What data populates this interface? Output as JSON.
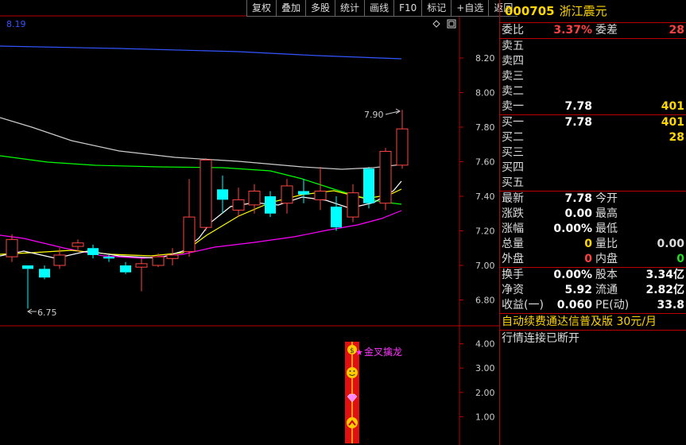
{
  "toolbar": [
    "复权",
    "叠加",
    "多股",
    "统计",
    "画线",
    "F10",
    "标记",
    "+自选",
    "返回"
  ],
  "chart": {
    "ma_label": "8.19",
    "price_axis": [
      "8.20",
      "8.00",
      "7.80",
      "7.60",
      "7.40",
      "7.20",
      "7.00",
      "6.80"
    ],
    "high_mark": "7.90",
    "low_mark": "6.75",
    "indicator_axis": [
      "4.00",
      "3.00",
      "2.00",
      "1.00"
    ],
    "signal_text": "金叉擒龙",
    "colors": {
      "up": "#ff4444",
      "down": "#00ffff",
      "ma5": "#ffffff",
      "ma10": "#ffff00",
      "ma20": "#ff00ff",
      "ma30": "#00ff00",
      "ma60": "#cccccc",
      "ma120": "#3355ff"
    }
  },
  "stock": {
    "code": "000705",
    "name": "浙江震元"
  },
  "weibi": {
    "label": "委比",
    "value": "3.37%",
    "label2": "委差",
    "value2": "28"
  },
  "sell": [
    {
      "label": "卖五",
      "price": "",
      "vol": ""
    },
    {
      "label": "卖四",
      "price": "",
      "vol": ""
    },
    {
      "label": "卖三",
      "price": "",
      "vol": ""
    },
    {
      "label": "卖二",
      "price": "",
      "vol": ""
    },
    {
      "label": "卖一",
      "price": "7.78",
      "vol": "401"
    }
  ],
  "buy": [
    {
      "label": "买一",
      "price": "7.78",
      "vol": "401"
    },
    {
      "label": "买二",
      "price": "",
      "vol": "28"
    },
    {
      "label": "买三",
      "price": "",
      "vol": ""
    },
    {
      "label": "买四",
      "price": "",
      "vol": ""
    },
    {
      "label": "买五",
      "price": "",
      "vol": ""
    }
  ],
  "quote1": [
    {
      "l1": "最新",
      "v1": "7.78",
      "l2": "今开",
      "v2": ""
    },
    {
      "l1": "涨跌",
      "v1": "0.00",
      "l2": "最高",
      "v2": ""
    },
    {
      "l1": "涨幅",
      "v1": "0.00%",
      "l2": "最低",
      "v2": ""
    },
    {
      "l1": "总量",
      "v1": "0",
      "l2": "量比",
      "v2": "0.00"
    },
    {
      "l1": "外盘",
      "v1": "0",
      "l2": "内盘",
      "v2": "0"
    }
  ],
  "quote2": [
    {
      "l1": "换手",
      "v1": "0.00%",
      "l2": "股本",
      "v2": "3.34亿"
    },
    {
      "l1": "净资",
      "v1": "5.92",
      "l2": "流通",
      "v2": "2.82亿"
    },
    {
      "l1": "收益(一)",
      "v1": "0.060",
      "l2": "PE(动)",
      "v2": "33.8"
    }
  ],
  "ad": {
    "text": "自动续费通达信普及版",
    "price": "30元/月"
  },
  "status": "行情连接已断开"
}
